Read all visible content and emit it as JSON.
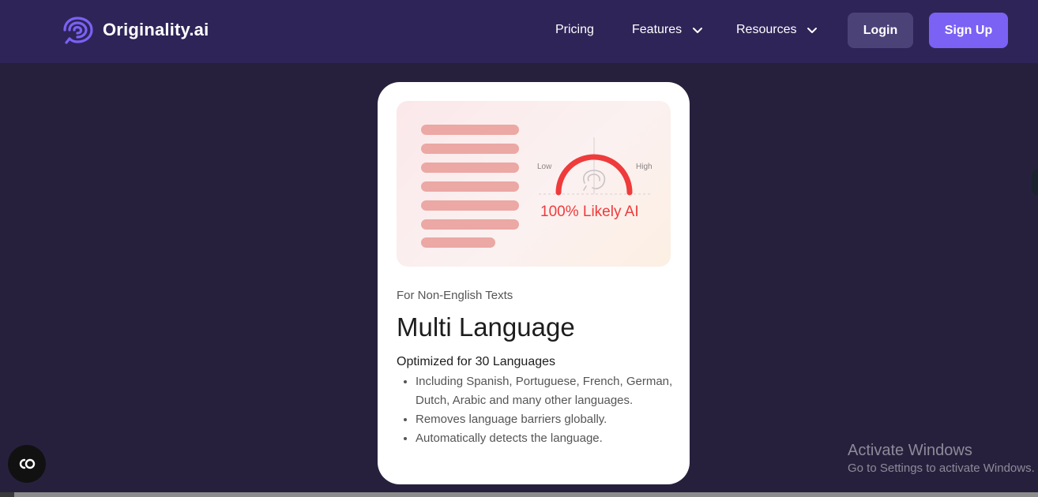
{
  "brand": {
    "name": "Originality.ai",
    "logo_color": "#7b61f4"
  },
  "nav": {
    "pricing": "Pricing",
    "features": "Features",
    "resources": "Resources",
    "login": "Login",
    "signup": "Sign Up"
  },
  "card": {
    "illustration": {
      "low_label": "Low",
      "high_label": "High",
      "result": "100% Likely AI",
      "accent": "#ef3b3b"
    },
    "eyebrow": "For Non-English Texts",
    "title": "Multi Language",
    "subtitle": "Optimized for 30 Languages",
    "bullets": [
      "Including Spanish, Portuguese, French, German, Dutch, Arabic and many other languages.",
      "Removes language barriers globally.",
      "Automatically detects the language."
    ]
  },
  "overlay": {
    "activate_title": "Activate Windows",
    "activate_sub": "Go to Settings to activate Windows."
  },
  "colors": {
    "nav_bg": "#2f2458",
    "page_bg": "#27203d",
    "signup_bg": "#7b61f4",
    "login_bg": "#4b4278"
  }
}
